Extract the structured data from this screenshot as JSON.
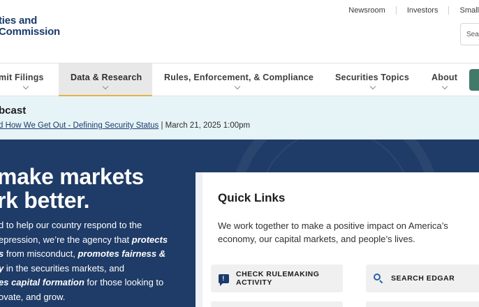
{
  "header": {
    "logo_line1": "ties and",
    "logo_line2": "Commission",
    "utility_links": [
      "Newsroom",
      "Investors",
      "Small"
    ],
    "search_placeholder": "Sea"
  },
  "nav": {
    "items": [
      {
        "label": "mit Filings"
      },
      {
        "label": "Data & Research"
      },
      {
        "label": "Rules, Enforcement, & Compliance"
      },
      {
        "label": "Securities Topics"
      },
      {
        "label": "About"
      }
    ],
    "active_index": 1
  },
  "banner": {
    "title": "bcast",
    "link_text": "d How We Get Out - Defining Security Status",
    "separator": "|",
    "date": "March 21, 2025 1:00pm"
  },
  "hero": {
    "title_line1": "make markets",
    "title_line2": "rk better.",
    "text_1": "d to help our country respond to the",
    "text_2": "epression, we’re the agency that ",
    "text_2_bold": "protects",
    "text_3_bold": "s",
    "text_3": " from misconduct, ",
    "text_3_bold2": "promotes fairness &",
    "text_4_bold": "y",
    "text_4": " in the securities markets, and",
    "text_5_bold": "es capital formation",
    "text_5": " for those looking to",
    "text_6": "ovate, and grow."
  },
  "quick_links": {
    "title": "Quick Links",
    "description": "We work together to make a positive impact on America’s economy, our capital markets, and people’s lives.",
    "items": [
      {
        "label": "CHECK RULEMAKING ACTIVITY",
        "icon": "comment-icon"
      },
      {
        "label": "SEARCH EDGAR",
        "icon": "search-icon"
      }
    ]
  },
  "colors": {
    "brand_navy": "#1f3b67",
    "logo_navy": "#1a3b6b",
    "active_tab_underline": "#e2b24a",
    "banner_bg": "#e7f4f7",
    "green_button": "#417a69"
  }
}
